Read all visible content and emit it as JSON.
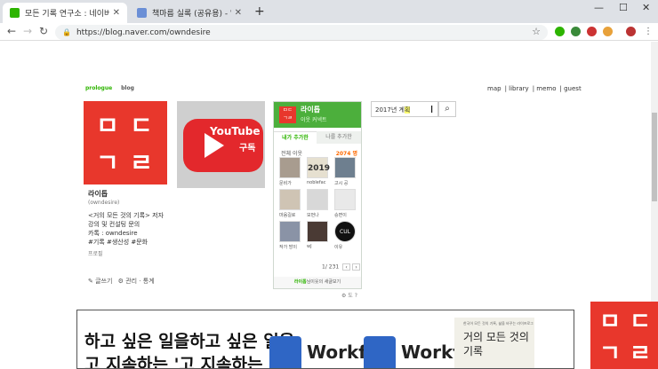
{
  "browser": {
    "tabs": [
      {
        "title": "모든 기록 연구소 : 네이버 블로",
        "active": true
      },
      {
        "title": "책마름 실록 (공유용) - WorkFlo",
        "active": false
      }
    ],
    "new_tab": "+",
    "url": "https://blog.naver.com/owndesire",
    "window_controls": {
      "minimize": "—",
      "maximize": "☐",
      "close": "✕"
    }
  },
  "blog": {
    "top_left": {
      "prologue": "prologue",
      "blog": "blog"
    },
    "top_right": [
      "map",
      "library",
      "memo",
      "guest"
    ],
    "logo_glyphs": [
      "ㅁ",
      "ㄷ",
      "ㄱ",
      "ㄹ"
    ],
    "youtube": {
      "label": "YouTube",
      "subscribe": "구독"
    },
    "profile": {
      "name": "라이톱",
      "id": "(owndesire)",
      "lines": [
        "<거의 모든 것의 기록> 저자",
        "강의 및 컨설팅 문의",
        "카톡 : owndesire",
        "#기록 #생산성 #문화"
      ],
      "profile_link": "프로필",
      "write": "글쓰기",
      "manage": "관리 · 통계"
    },
    "neighbor_widget": {
      "name": "라이톱",
      "subtitle": "이웃 커넥트",
      "tab_mine": "내가 추가한",
      "tab_others": "나를 추가한",
      "all_label": "전체 이웃",
      "count": "2074 명",
      "items": [
        "문비가",
        "noblefac",
        "고시 공",
        "마음길로",
        "모먼나",
        "승면이",
        "작가 방이",
        "wJ",
        "이유"
      ],
      "thumb_texts": [
        "",
        "2019",
        "",
        "",
        "",
        "",
        "",
        "",
        "CUL"
      ],
      "pager": "1/ 231",
      "prev": "‹",
      "next": "›",
      "footer_highlight": "라이톱",
      "footer_text": "님이웃의 새글보기"
    },
    "widget_settings": "⚙ 도 ?",
    "search": {
      "value_prefix": "2017년 계",
      "value_highlight": "획",
      "button_icon": "search-icon"
    },
    "post": {
      "line1": "하고 싶은 일을하고 싶은 일을",
      "line2": "고 지속하는 '고 지속하는 '",
      "workflowy_label": "Workfl",
      "book_kicker": "한국어 모든 것의 기록, 삶을 바꾸는 라이프로그",
      "book_title": "거의 모든 것의 기록"
    }
  },
  "colors": {
    "naver_green": "#2db400",
    "brand_red": "#e8372c",
    "youtube_red": "#e3282c",
    "workflowy_blue": "#2f66c5"
  }
}
